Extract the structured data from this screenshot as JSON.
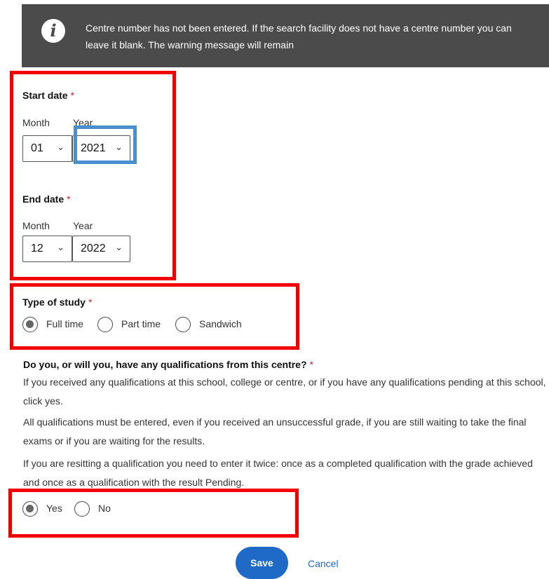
{
  "banner": {
    "icon": "info-icon",
    "message": "Centre number has not been entered. If the search facility does not have a centre number you can leave it blank. The warning message will remain"
  },
  "start_date": {
    "label": "Start date",
    "required_mark": "*",
    "month_label": "Month",
    "year_label": "Year",
    "month_value": "01",
    "year_value": "2021"
  },
  "end_date": {
    "label": "End date",
    "required_mark": "*",
    "month_label": "Month",
    "year_label": "Year",
    "month_value": "12",
    "year_value": "2022"
  },
  "type_of_study": {
    "label": "Type of study",
    "required_mark": "*",
    "options": [
      "Full time",
      "Part time",
      "Sandwich"
    ],
    "selected": "Full time"
  },
  "qualifications": {
    "question": "Do you, or will you, have any qualifications from this centre?",
    "required_mark": "*",
    "para1": "If you received any qualifications at this school, college or centre, or if you have any qualifications pending at this school, click yes.",
    "para2": "All qualifications must be entered, even if you received an unsuccessful grade, if you are still waiting to take the final exams or if you are waiting for the results.",
    "para3": "If you are resitting a qualification you need to enter it twice: once as a completed qualification with the grade achieved and once as a qualification with the result Pending.",
    "options": [
      "Yes",
      "No"
    ],
    "selected": "Yes"
  },
  "actions": {
    "save_label": "Save",
    "cancel_label": "Cancel"
  },
  "highlight_colors": {
    "red": "#f20000",
    "blue": "#4a8fd0"
  }
}
